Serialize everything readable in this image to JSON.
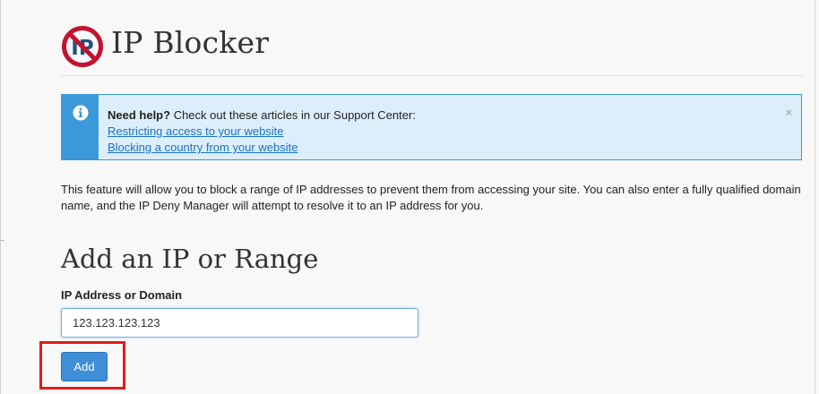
{
  "header": {
    "title": "IP Blocker",
    "logo_icon": "ip-blocked-icon",
    "logo_color": "#c4122f",
    "logo_text_color": "#22547c"
  },
  "alert": {
    "icon": "info-icon",
    "heading": "Need help?",
    "text": " Check out these articles in our Support Center:",
    "links": [
      "Restricting access to your website",
      "Blocking a country from your website"
    ],
    "close_icon": "×",
    "accent": "#3b99d9",
    "background": "#dceefa"
  },
  "description": "This feature will allow you to block a range of IP addresses to prevent them from accessing your site. You can also enter a fully qualified domain name, and the IP Deny Manager will attempt to resolve it to an IP address for you.",
  "form": {
    "section_title": "Add an IP or Range",
    "field_label": "IP Address or Domain",
    "ip_value": "123.123.123.123",
    "add_label": "Add",
    "highlight_color": "#e21c1c"
  }
}
